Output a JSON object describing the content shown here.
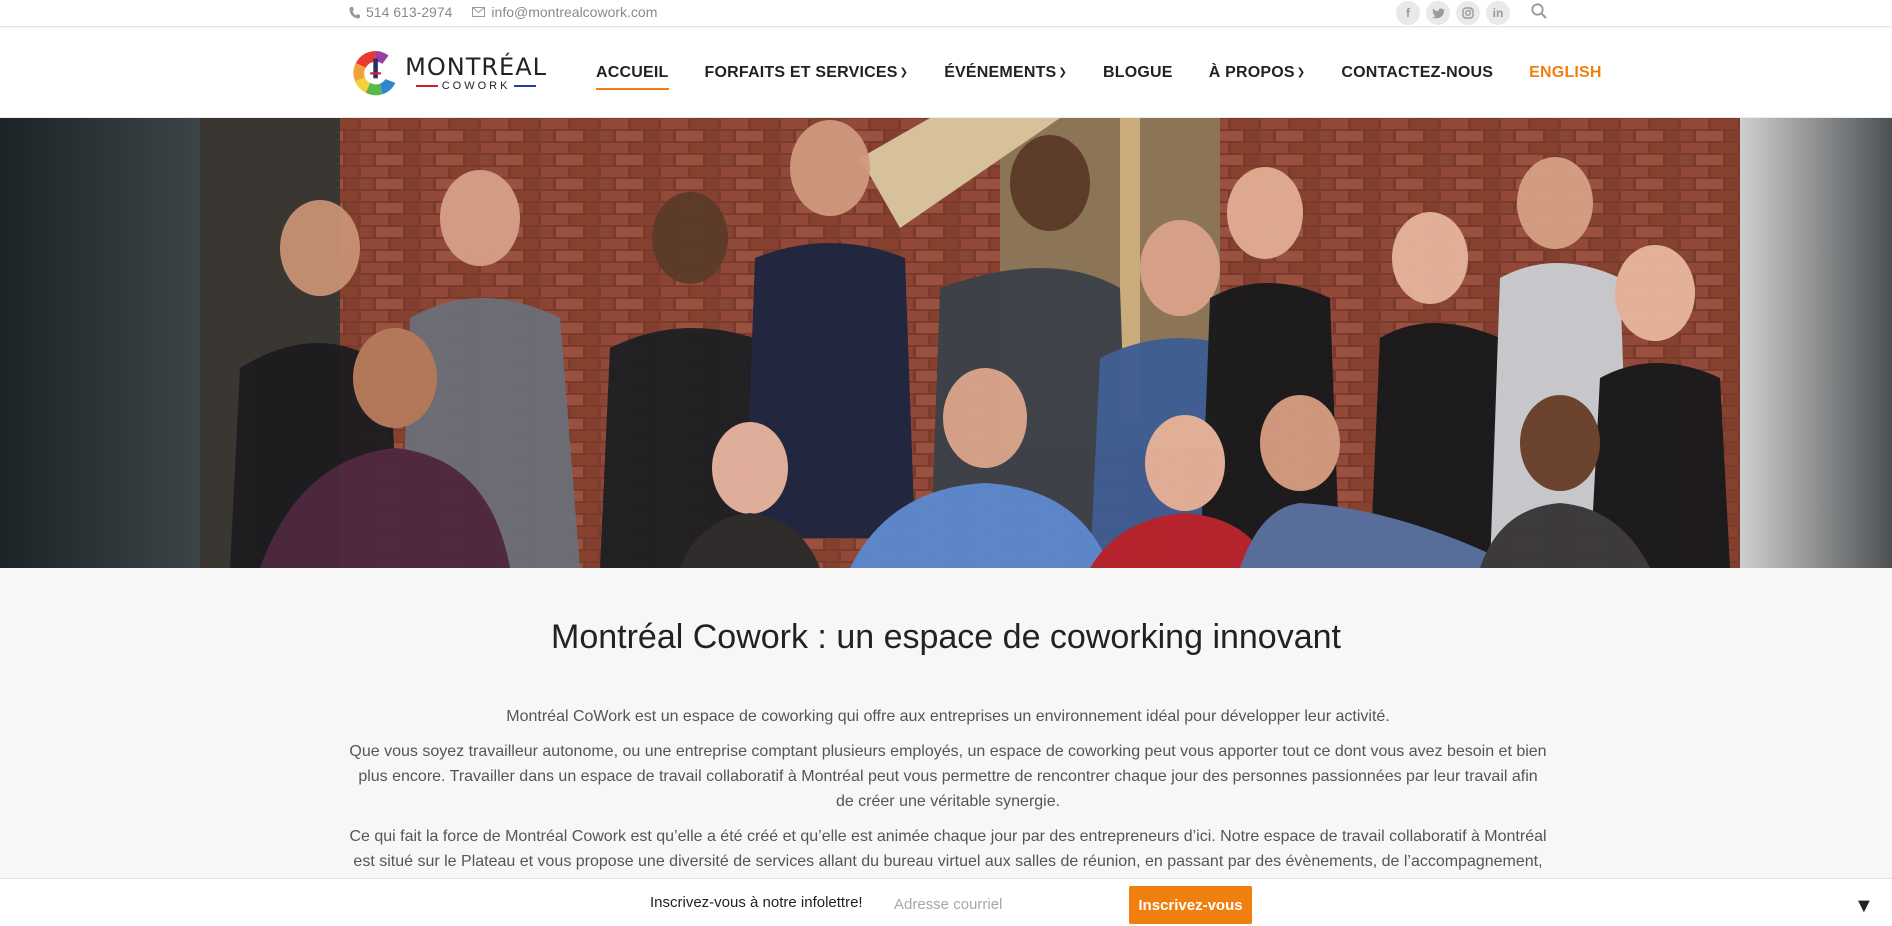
{
  "topbar": {
    "phone": "514 613-2974",
    "email": "info@montrealcowork.com",
    "social": [
      "f",
      "t",
      "ig",
      "in"
    ]
  },
  "logo": {
    "line1": "MONTRÉAL",
    "line2": "COWORK"
  },
  "nav": {
    "items": [
      {
        "label": "ACCUEIL"
      },
      {
        "label": "FORFAITS ET SERVICES"
      },
      {
        "label": "ÉVÉNEMENTS"
      },
      {
        "label": "BLOGUE"
      },
      {
        "label": "À PROPOS"
      },
      {
        "label": "CONTACTEZ-NOUS"
      },
      {
        "label": "ENGLISH"
      }
    ]
  },
  "colors": {
    "accent": "#f07f0f",
    "text": "#222222",
    "muted": "#555555"
  },
  "content": {
    "title": "Montréal Cowork : un espace de coworking innovant",
    "p1": "Montréal CoWork est un espace de coworking qui offre aux entreprises un environnement idéal pour développer leur activité.",
    "p2": "Que vous soyez travailleur autonome, ou une entreprise comptant plusieurs employés, un espace de coworking peut vous apporter tout ce dont vous avez besoin et bien plus encore. Travailler dans un espace de travail collaboratif à Montréal peut vous permettre de rencontrer chaque jour des personnes passionnées par leur travail afin de créer une véritable synergie.",
    "p3": "Ce qui fait la force de Montréal Cowork est qu’elle a été créé et qu’elle est animée chaque jour par des entrepreneurs d’ici. Notre espace de travail collaboratif à Montréal est situé sur le Plateau et vous propose une diversité de services allant du bureau virtuel aux salles de réunion, en passant par des évènements, de l’accompagnement,"
  },
  "newsletter": {
    "label": "Inscrivez-vous à notre infolettre!",
    "placeholder": "Adresse courriel",
    "button": "Inscrivez-vous",
    "toggle": "▼"
  }
}
